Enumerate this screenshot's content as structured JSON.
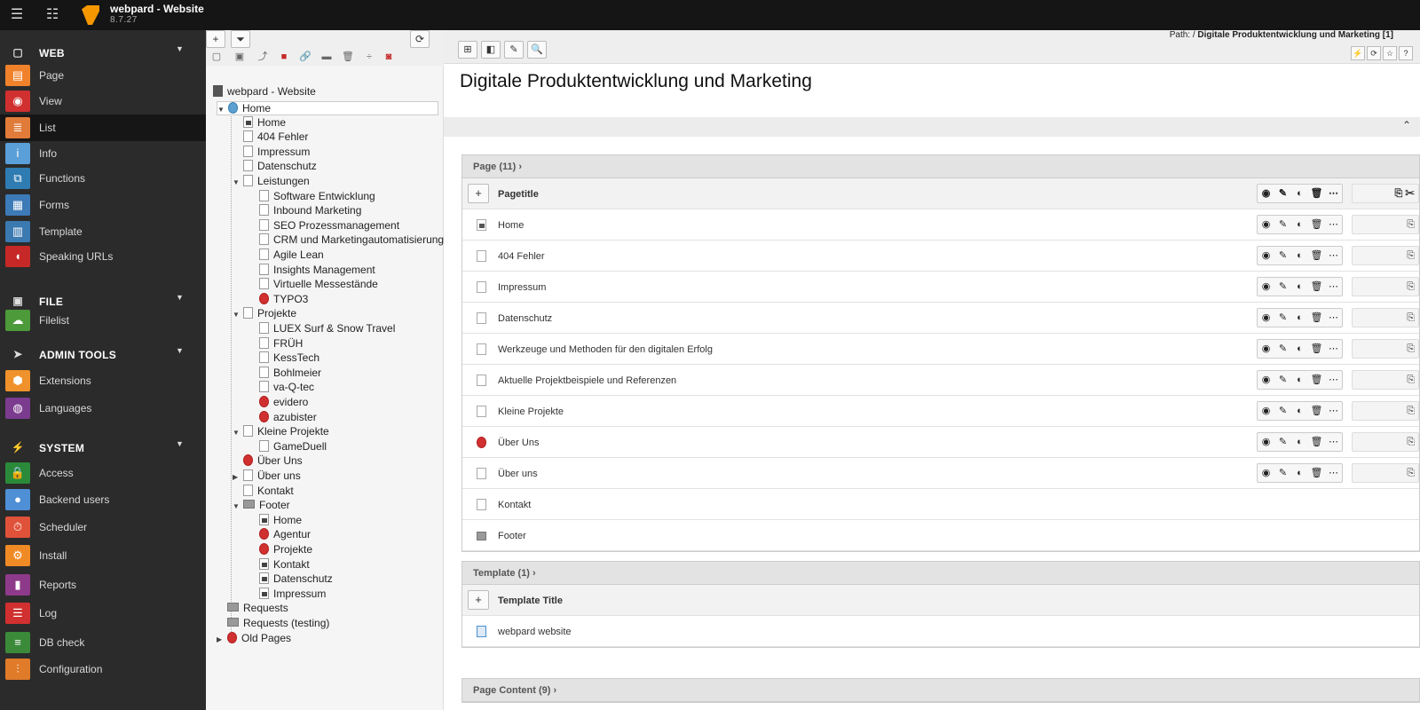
{
  "topbar": {
    "site_name": "webpard - Website",
    "version": "8.7.27",
    "path_label": "Path: /",
    "path_current": "Digitale Produktentwicklung und Marketing [1]"
  },
  "module_menu": {
    "groups": [
      {
        "label": "WEB",
        "icon": "globe-icon",
        "modules": [
          {
            "label": "Page",
            "icon": "page-icon",
            "color": "#f0822b"
          },
          {
            "label": "View",
            "icon": "eye-icon",
            "color": "#d0302f"
          },
          {
            "label": "List",
            "icon": "list-icon",
            "color": "#e07b3a",
            "active": true
          },
          {
            "label": "Info",
            "icon": "info-icon",
            "color": "#5a9fd8"
          },
          {
            "label": "Functions",
            "icon": "functions-icon",
            "color": "#2f7cb2"
          },
          {
            "label": "Forms",
            "icon": "forms-icon",
            "color": "#3c7ab8"
          },
          {
            "label": "Template",
            "icon": "template-icon",
            "color": "#3b79b1"
          },
          {
            "label": "Speaking URLs",
            "icon": "pill-icon",
            "color": "#c62828"
          }
        ]
      },
      {
        "label": "FILE",
        "icon": "image-icon",
        "modules": [
          {
            "label": "Filelist",
            "icon": "filelist-icon",
            "color": "#4d9a3a"
          }
        ]
      },
      {
        "label": "ADMIN TOOLS",
        "icon": "rocket-icon",
        "modules": [
          {
            "label": "Extensions",
            "icon": "extensions-icon",
            "color": "#f0922b"
          },
          {
            "label": "Languages",
            "icon": "languages-icon",
            "color": "#7b3b8e"
          }
        ]
      },
      {
        "label": "SYSTEM",
        "icon": "plug-icon",
        "modules": [
          {
            "label": "Access",
            "icon": "lock-icon",
            "color": "#2a8a3a"
          },
          {
            "label": "Backend users",
            "icon": "user-icon",
            "color": "#4f8fd6"
          },
          {
            "label": "Scheduler",
            "icon": "scheduler-icon",
            "color": "#e0513a"
          },
          {
            "label": "Install",
            "icon": "install-icon",
            "color": "#f08a25"
          },
          {
            "label": "Reports",
            "icon": "reports-icon",
            "color": "#8e3a8a"
          },
          {
            "label": "Log",
            "icon": "log-icon",
            "color": "#d0302f"
          },
          {
            "label": "DB check",
            "icon": "db-icon",
            "color": "#3b8a3a"
          },
          {
            "label": "Configuration",
            "icon": "configuration-icon",
            "color": "#e07b2a"
          }
        ]
      }
    ]
  },
  "page_tree": {
    "root": "webpard - Website",
    "nodes": [
      {
        "label": "Home",
        "depth": 0,
        "icon": "globe",
        "toggle": "▼",
        "selected": true
      },
      {
        "label": "Home",
        "depth": 1,
        "icon": "short"
      },
      {
        "label": "404 Fehler",
        "depth": 1,
        "icon": "page"
      },
      {
        "label": "Impressum",
        "depth": 1,
        "icon": "page"
      },
      {
        "label": "Datenschutz",
        "depth": 1,
        "icon": "page"
      },
      {
        "label": "Leistungen",
        "depth": 1,
        "icon": "page",
        "toggle": "▼"
      },
      {
        "label": "Software Entwicklung",
        "depth": 2,
        "icon": "page"
      },
      {
        "label": "Inbound Marketing",
        "depth": 2,
        "icon": "page"
      },
      {
        "label": "SEO Prozessmanagement",
        "depth": 2,
        "icon": "page"
      },
      {
        "label": "CRM und Marketingautomatisierung",
        "depth": 2,
        "icon": "page"
      },
      {
        "label": "Agile Lean",
        "depth": 2,
        "icon": "page"
      },
      {
        "label": "Insights Management",
        "depth": 2,
        "icon": "page"
      },
      {
        "label": "Virtuelle Messestände",
        "depth": 2,
        "icon": "page"
      },
      {
        "label": "TYPO3",
        "depth": 2,
        "icon": "red"
      },
      {
        "label": "Projekte",
        "depth": 1,
        "icon": "page",
        "toggle": "▼"
      },
      {
        "label": "LUEX Surf & Snow Travel",
        "depth": 2,
        "icon": "page"
      },
      {
        "label": "FRÜH",
        "depth": 2,
        "icon": "page"
      },
      {
        "label": "KessTech",
        "depth": 2,
        "icon": "page"
      },
      {
        "label": "Bohlmeier",
        "depth": 2,
        "icon": "page"
      },
      {
        "label": "va-Q-tec",
        "depth": 2,
        "icon": "page"
      },
      {
        "label": "evidero",
        "depth": 2,
        "icon": "red"
      },
      {
        "label": "azubister",
        "depth": 2,
        "icon": "red"
      },
      {
        "label": "Kleine Projekte",
        "depth": 1,
        "icon": "page",
        "toggle": "▼"
      },
      {
        "label": "GameDuell",
        "depth": 2,
        "icon": "page"
      },
      {
        "label": "Über Uns",
        "depth": 1,
        "icon": "red"
      },
      {
        "label": "Über uns",
        "depth": 1,
        "icon": "page",
        "toggle": "▶"
      },
      {
        "label": "Kontakt",
        "depth": 1,
        "icon": "page"
      },
      {
        "label": "Footer",
        "depth": 1,
        "icon": "folder",
        "toggle": "▼"
      },
      {
        "label": "Home",
        "depth": 2,
        "icon": "short"
      },
      {
        "label": "Agentur",
        "depth": 2,
        "icon": "red"
      },
      {
        "label": "Projekte",
        "depth": 2,
        "icon": "red"
      },
      {
        "label": "Kontakt",
        "depth": 2,
        "icon": "short"
      },
      {
        "label": "Datenschutz",
        "depth": 2,
        "icon": "short"
      },
      {
        "label": "Impressum",
        "depth": 2,
        "icon": "short"
      },
      {
        "label": "Requests",
        "depth": 0,
        "icon": "folder"
      },
      {
        "label": "Requests (testing)",
        "depth": 0,
        "icon": "folder"
      },
      {
        "label": "Old Pages",
        "depth": 0,
        "icon": "red",
        "toggle": "▶"
      }
    ]
  },
  "content": {
    "title": "Digitale Produktentwicklung und Marketing",
    "page_table": {
      "heading": "Page (11)",
      "column_title": "Pagetitle",
      "rows": [
        {
          "label": "Home",
          "icon": "home"
        },
        {
          "label": "404 Fehler",
          "icon": "page"
        },
        {
          "label": "Impressum",
          "icon": "page"
        },
        {
          "label": "Datenschutz",
          "icon": "page"
        },
        {
          "label": "Werkzeuge und Methoden für den digitalen Erfolg",
          "icon": "page"
        },
        {
          "label": "Aktuelle Projektbeispiele und Referenzen",
          "icon": "page"
        },
        {
          "label": "Kleine Projekte",
          "icon": "page"
        },
        {
          "label": "Über Uns",
          "icon": "red"
        },
        {
          "label": "Über uns",
          "icon": "page"
        },
        {
          "label": "Kontakt",
          "icon": "page"
        },
        {
          "label": "Footer",
          "icon": "folder"
        }
      ]
    },
    "template_table": {
      "heading": "Template (1)",
      "column_title": "Template Title",
      "rows": [
        {
          "label": "webpard website",
          "icon": "tpl"
        }
      ]
    },
    "content_table": {
      "heading": "Page Content (9)"
    }
  }
}
